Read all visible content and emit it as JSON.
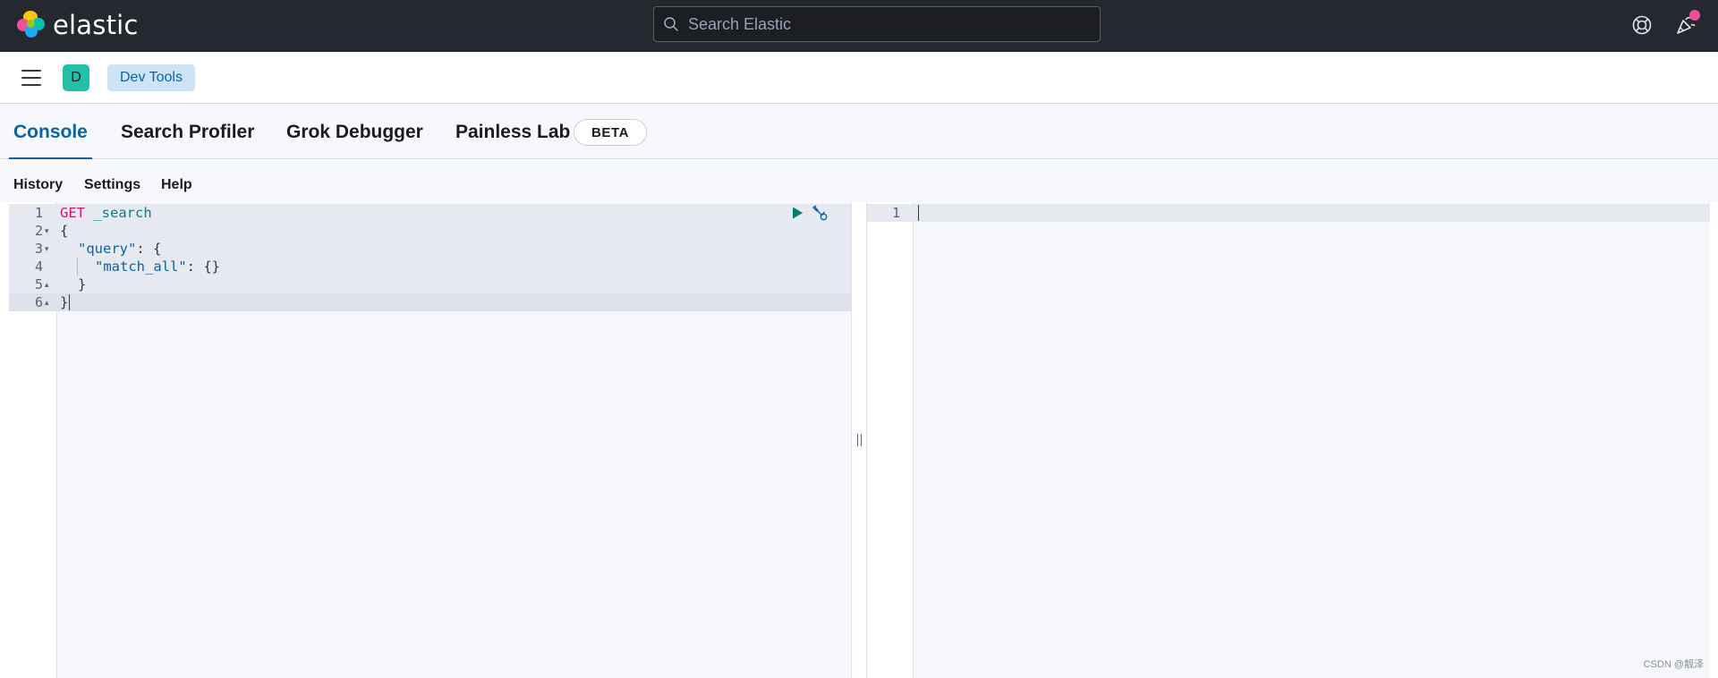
{
  "header": {
    "brand": "elastic",
    "search_placeholder": "Search Elastic"
  },
  "subbar": {
    "space_initial": "D",
    "breadcrumb": "Dev Tools"
  },
  "tabs": [
    {
      "label": "Console",
      "active": true
    },
    {
      "label": "Search Profiler",
      "active": false
    },
    {
      "label": "Grok Debugger",
      "active": false
    },
    {
      "label": "Painless Lab",
      "active": false
    }
  ],
  "beta_badge": "BETA",
  "console_menu": [
    "History",
    "Settings",
    "Help"
  ],
  "request_editor": {
    "line_numbers": [
      "1",
      "2",
      "3",
      "4",
      "5",
      "6"
    ],
    "method": "GET",
    "url": "_search",
    "lines": {
      "l2": "{",
      "l3_key": "\"query\"",
      "l3_rest": ": {",
      "l4_key": "\"match_all\"",
      "l4_rest": ": {}",
      "l5": "}",
      "l6": "}"
    }
  },
  "response_editor": {
    "line_numbers": [
      "1"
    ]
  },
  "watermark": "CSDN @靓泽",
  "colors": {
    "header_bg": "#25282f",
    "accent": "#0b64a1",
    "space_avatar": "#23bfa9",
    "notification_dot": "#f04e98",
    "run_icon": "#017d73"
  }
}
